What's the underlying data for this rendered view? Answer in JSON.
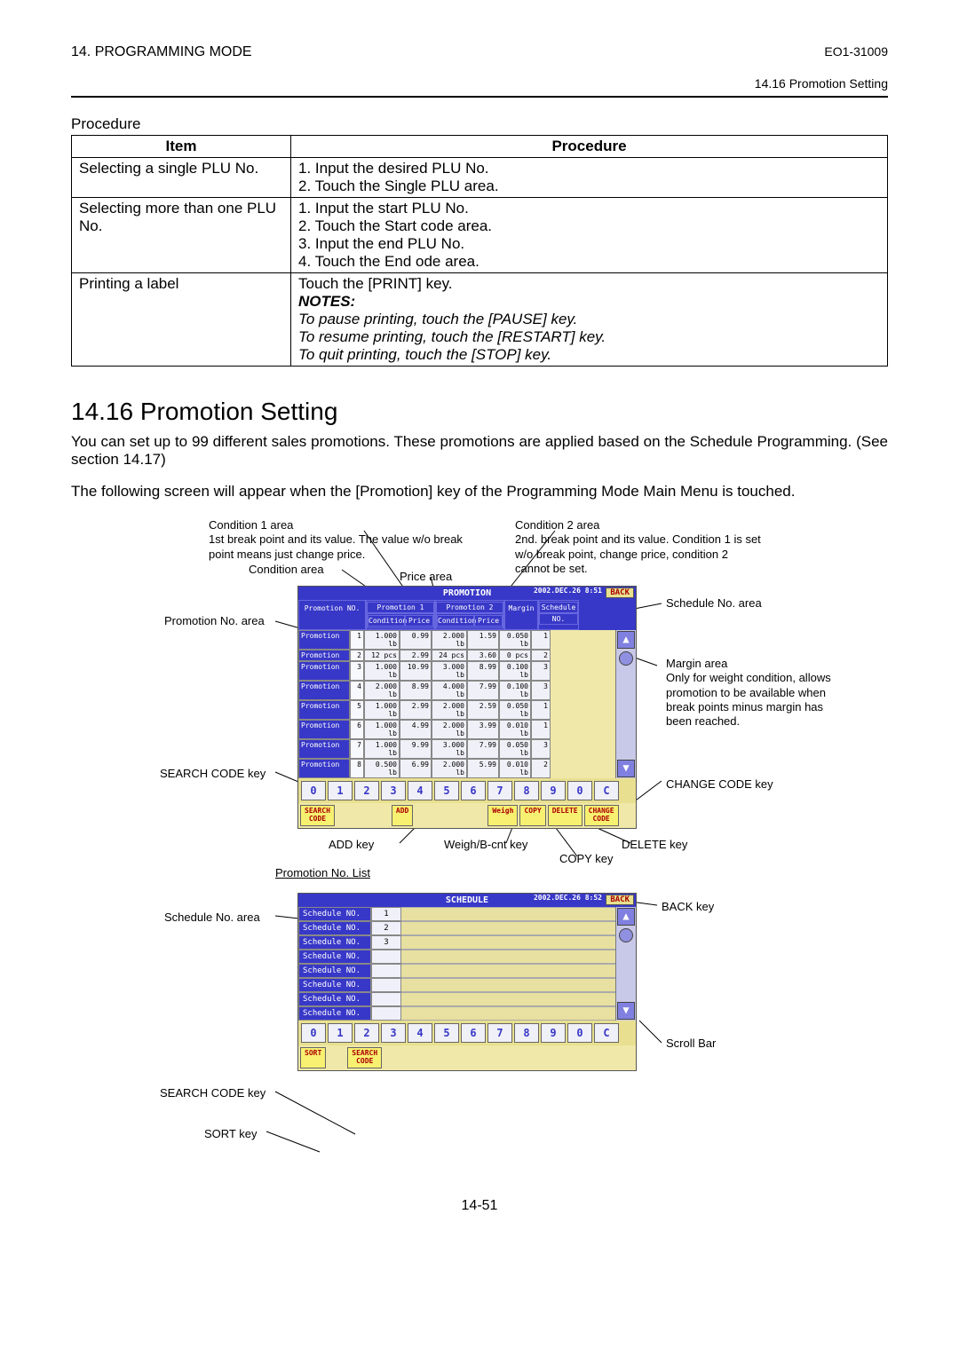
{
  "header": {
    "chapter": "14. PROGRAMMING MODE",
    "doc_id": "EO1-31009",
    "sub": "14.16 Promotion Setting"
  },
  "procedure": {
    "label": "Procedure",
    "head_item": "Item",
    "head_proc": "Procedure",
    "rows": [
      {
        "item": "Selecting a single PLU No.",
        "steps": [
          "1. Input the desired PLU No.",
          "2. Touch the Single PLU area."
        ]
      },
      {
        "item": "Selecting more than one PLU No.",
        "steps": [
          "1. Input the start PLU No.",
          "2. Touch the Start code area.",
          "3. Input the end PLU No.",
          "4. Touch the End ode area."
        ]
      },
      {
        "item": "Printing a label",
        "steps": [
          "Touch the [PRINT] key."
        ],
        "notes_title": "NOTES:",
        "notes": [
          "To pause printing, touch the [PAUSE] key.",
          "To resume printing, touch the [RESTART] key.",
          "To quit printing, touch the [STOP] key."
        ]
      }
    ]
  },
  "section": {
    "heading": "14.16  Promotion Setting",
    "para1": "You can set up to 99 different sales promotions.  These promotions are applied based on the Schedule Programming. (See section 14.17)",
    "para2": "The following screen will appear when the [Promotion]  key of the Programming Mode Main Menu is touched."
  },
  "annotations_screen1": {
    "cond1_area": "Condition 1 area",
    "cond1_desc": "1st break point and its value. The value w/o break point means just change price.",
    "cond_area": "Condition area",
    "price_area": "Price area",
    "promo_no_area": "Promotion No. area",
    "search_code": "SEARCH CODE key",
    "add_key": "ADD key",
    "weigh_key": "Weigh/B-cnt key",
    "copy_key": "COPY key",
    "delete_key": "DELETE key",
    "change_code": "CHANGE CODE key",
    "cond2_area": "Condition 2 area",
    "cond2_desc": "2nd. break point and its value. Condition 1 is set w/o break point, change price, condition 2 cannot be set.",
    "schedule_area": "Schedule No. area",
    "margin_area": "Margin area",
    "margin_desc": "Only for weight condition, allows promotion to be available when break points minus margin has been reached.",
    "list_title": "Promotion No. List"
  },
  "annotations_screen2": {
    "schedule_no": "Schedule No. area",
    "search_code": "SEARCH CODE key",
    "sort_key": "SORT key",
    "back_key": "BACK key",
    "scroll_bar": "Scroll Bar"
  },
  "screen1": {
    "title": "PROMOTION",
    "date": "2002.DEC.26\n8:51",
    "back": "BACK",
    "header": {
      "promo_no": "Promotion NO.",
      "prom1": "Promotion 1",
      "prom2": "Promotion 2",
      "cond": "Condition",
      "price": "Price",
      "schedule": "Schedule",
      "margin": "Margin",
      "no": "NO."
    },
    "rows": [
      {
        "label": "Promotion",
        "n": "1",
        "c1": "1.000 lb",
        "p1": "0.99",
        "c2": "2.000 lb",
        "p2": "1.59",
        "m": "0.050 lb",
        "s": "1"
      },
      {
        "label": "Promotion",
        "n": "2",
        "c1": "12 pcs",
        "p1": "2.99",
        "c2": "24 pcs",
        "p2": "3.60",
        "m": "0 pcs",
        "s": "2"
      },
      {
        "label": "Promotion",
        "n": "3",
        "c1": "1.000 lb",
        "p1": "10.99",
        "c2": "3.000 lb",
        "p2": "8.99",
        "m": "0.100 lb",
        "s": "3"
      },
      {
        "label": "Promotion",
        "n": "4",
        "c1": "2.000 lb",
        "p1": "8.99",
        "c2": "4.000 lb",
        "p2": "7.99",
        "m": "0.100 lb",
        "s": "3"
      },
      {
        "label": "Promotion",
        "n": "5",
        "c1": "1.000 lb",
        "p1": "2.99",
        "c2": "2.000 lb",
        "p2": "2.59",
        "m": "0.050 lb",
        "s": "1"
      },
      {
        "label": "Promotion",
        "n": "6",
        "c1": "1.000 lb",
        "p1": "4.99",
        "c2": "2.000 lb",
        "p2": "3.99",
        "m": "0.010 lb",
        "s": "1"
      },
      {
        "label": "Promotion",
        "n": "7",
        "c1": "1.000 lb",
        "p1": "9.99",
        "c2": "3.000 lb",
        "p2": "7.99",
        "m": "0.050 lb",
        "s": "3"
      },
      {
        "label": "Promotion",
        "n": "8",
        "c1": "0.500 lb",
        "p1": "6.99",
        "c2": "2.000 lb",
        "p2": "5.99",
        "m": "0.010 lb",
        "s": "2"
      }
    ],
    "keypad": [
      "0",
      "1",
      "2",
      "3",
      "4",
      "5",
      "6",
      "7",
      "8",
      "9",
      "0",
      "C"
    ],
    "func": {
      "search": "SEARCH\nCODE",
      "add": "ADD",
      "weigh": "Weigh",
      "copy": "COPY",
      "delete": "DELETE",
      "change": "CHANGE\nCODE"
    }
  },
  "screen2": {
    "title": "SCHEDULE",
    "date": "2002.DEC.26\n8:52",
    "back": "BACK",
    "rows": [
      {
        "label": "Schedule NO.",
        "val": "1"
      },
      {
        "label": "Schedule NO.",
        "val": "2"
      },
      {
        "label": "Schedule NO.",
        "val": "3"
      },
      {
        "label": "Schedule NO.",
        "val": ""
      },
      {
        "label": "Schedule NO.",
        "val": ""
      },
      {
        "label": "Schedule NO.",
        "val": ""
      },
      {
        "label": "Schedule NO.",
        "val": ""
      },
      {
        "label": "Schedule NO.",
        "val": ""
      }
    ],
    "keypad": [
      "0",
      "1",
      "2",
      "3",
      "4",
      "5",
      "6",
      "7",
      "8",
      "9",
      "0",
      "C"
    ],
    "func": {
      "sort": "SORT",
      "search": "SEARCH\nCODE"
    }
  },
  "page_num": "14-51"
}
